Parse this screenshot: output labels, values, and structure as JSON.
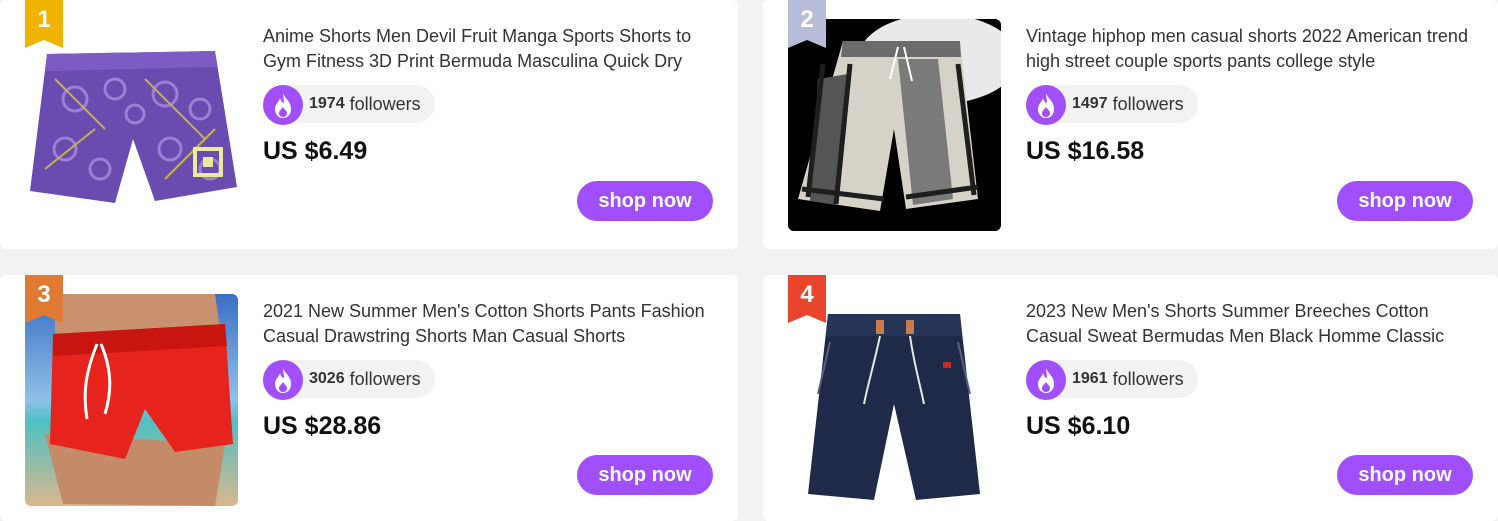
{
  "products": [
    {
      "rank": "1",
      "title": "Anime Shorts Men Devil Fruit Manga Sports Shorts to Gym Fitness 3D Print Bermuda Masculina Quick Dry",
      "followers_count": "1974",
      "followers_label": "followers",
      "price": "US $6.49",
      "button": "shop now",
      "rank_color": "#f0b400",
      "image": "purple-patterned-shorts"
    },
    {
      "rank": "2",
      "title": "Vintage hiphop men casual shorts 2022 American trend high street couple sports pants college style",
      "followers_count": "1497",
      "followers_label": "followers",
      "price": "US $16.58",
      "button": "shop now",
      "rank_color": "#b7bdd9",
      "image": "grey-striped-shorts"
    },
    {
      "rank": "3",
      "title": "2021 New Summer Men's Cotton Shorts Pants Fashion Casual Drawstring Shorts Man Casual Shorts",
      "followers_count": "3026",
      "followers_label": "followers",
      "price": "US $28.86",
      "button": "shop now",
      "rank_color": "#e07a32",
      "image": "red-swim-shorts"
    },
    {
      "rank": "4",
      "title": "2023 New Men's Shorts Summer Breeches Cotton Casual Sweat Bermudas Men Black Homme Classic",
      "followers_count": "1961",
      "followers_label": "followers",
      "price": "US $6.10",
      "button": "shop now",
      "rank_color": "#e8452c",
      "image": "navy-sweat-shorts"
    }
  ],
  "colors": {
    "accent": "#a14ffc",
    "background": "#f2f2f2",
    "card": "#ffffff"
  },
  "icons": {
    "followers": "fire-icon"
  }
}
